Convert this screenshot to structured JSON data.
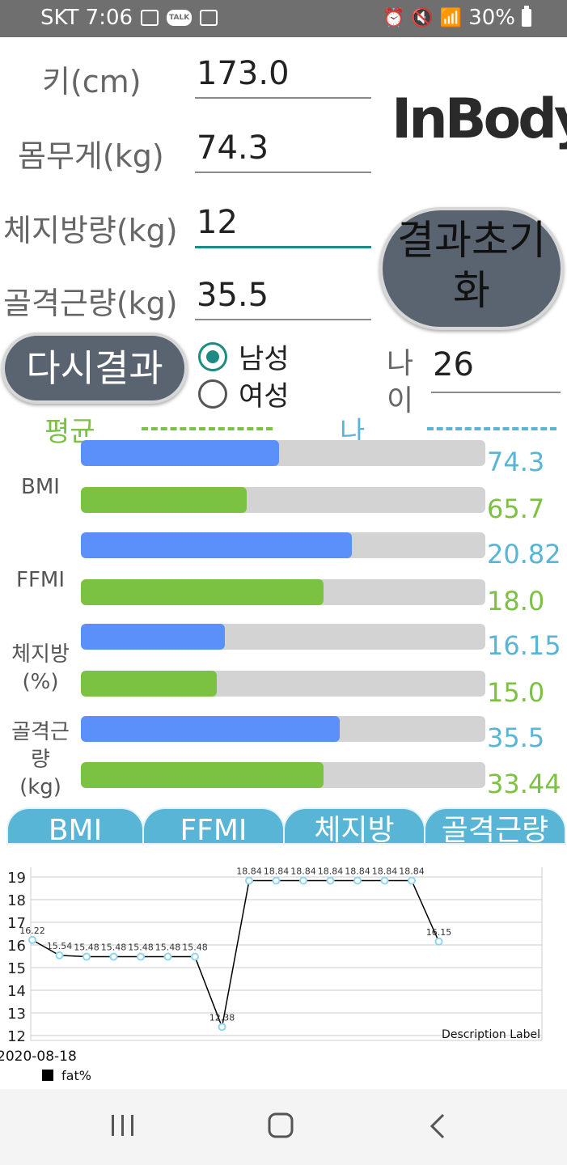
{
  "status": {
    "carrier_time": "SKT 7:06",
    "talk_badge": "TALK",
    "battery": "30%"
  },
  "form": {
    "height": {
      "label": "키(cm)",
      "value": "173.0"
    },
    "weight": {
      "label": "몸무게(kg)",
      "value": "74.3"
    },
    "fat": {
      "label": "체지방량(kg)",
      "value": "12"
    },
    "muscle": {
      "label": "골격근량(kg)",
      "value": "35.5"
    }
  },
  "logo": "InBody",
  "buttons": {
    "reset_line1": "결과초기",
    "reset_line2": "화",
    "again": "다시결과"
  },
  "gender": {
    "male": "남성",
    "female": "여성",
    "selected": "male"
  },
  "age": {
    "label_line1": "나",
    "label_line2": "이",
    "value": "26"
  },
  "legend": {
    "average": "평균",
    "me": "나",
    "average_color": "#7cc242",
    "me_color": "#58b5d6"
  },
  "colors": {
    "me_bar": "#5b8ff9",
    "avg_bar": "#7cc242",
    "track": "#d3d3d3",
    "me_text": "#58b5d6",
    "avg_text": "#7cc242"
  },
  "metrics": [
    {
      "label": "BMI",
      "me_value": "74.3",
      "me_frac": 0.49,
      "avg_value": "65.7",
      "avg_frac": 0.41
    },
    {
      "label": "FFMI",
      "me_value": "20.82",
      "me_frac": 0.67,
      "avg_value": "18.0",
      "avg_frac": 0.6
    },
    {
      "label": "체지방\n(%)",
      "me_value": "16.15",
      "me_frac": 0.356,
      "avg_value": "15.0",
      "avg_frac": 0.336
    },
    {
      "label": "골격근\n량\n(kg)",
      "me_value": "35.5",
      "me_frac": 0.64,
      "avg_value": "33.44",
      "avg_frac": 0.6
    }
  ],
  "tabs": [
    "BMI",
    "FFMI",
    "체지방",
    "골격근량"
  ],
  "chart_data": {
    "type": "line",
    "x_start_label": "2020-08-18",
    "description": "Description Label",
    "ylim": [
      12,
      19
    ],
    "yticks": [
      12,
      13,
      14,
      15,
      16,
      17,
      18,
      19
    ],
    "grid": true,
    "legend_position": "bottom-left",
    "series": [
      {
        "name": "fat%",
        "color": "#000000",
        "values": [
          16.22,
          15.54,
          15.48,
          15.48,
          15.48,
          15.48,
          15.48,
          12.38,
          18.84,
          18.84,
          18.84,
          18.84,
          18.84,
          18.84,
          18.84,
          16.15
        ]
      }
    ]
  }
}
